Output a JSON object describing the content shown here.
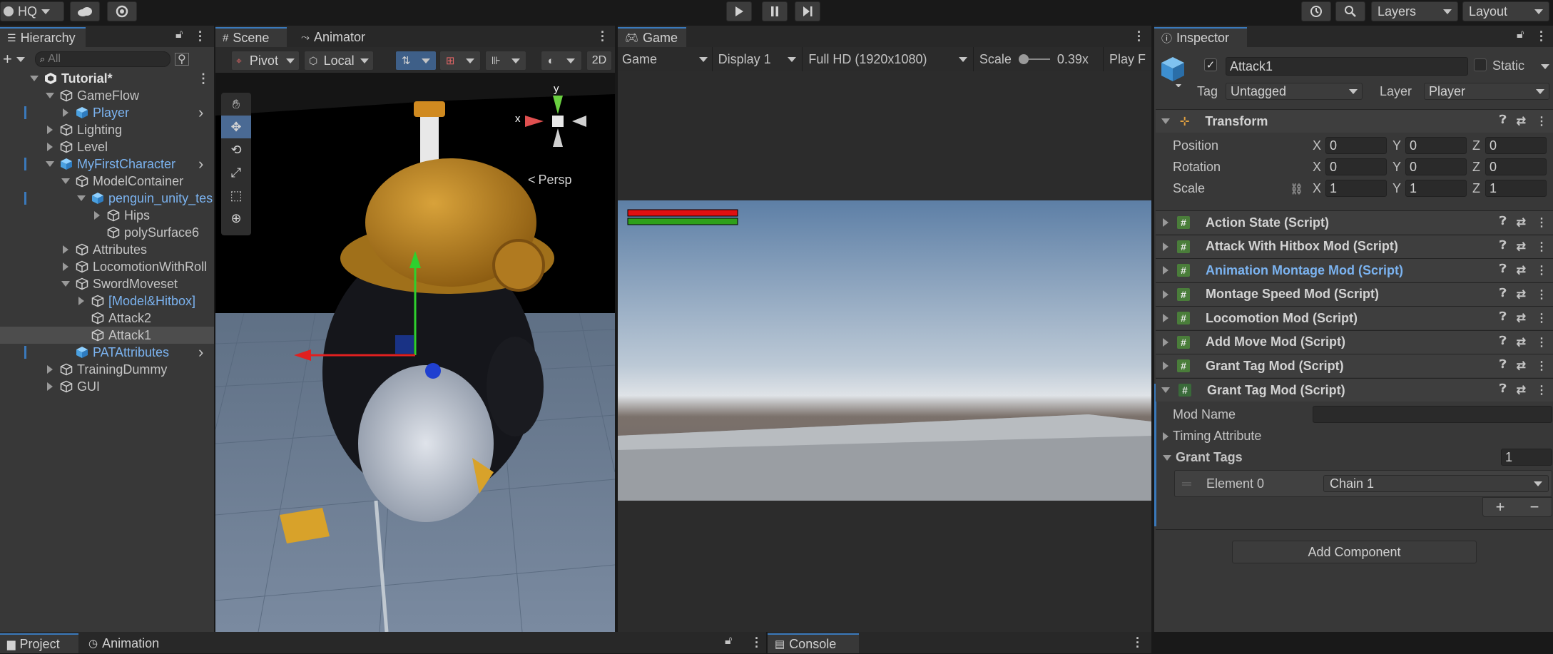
{
  "toolbar": {
    "account": "HQ",
    "layers": "Layers",
    "layout": "Layout"
  },
  "hierarchy": {
    "tab": "Hierarchy",
    "search_placeholder": "All",
    "rows": [
      {
        "label": "Tutorial*",
        "indent": 0,
        "fold": "open",
        "kind": "scene"
      },
      {
        "label": "GameFlow",
        "indent": 1,
        "fold": "open",
        "kind": "go"
      },
      {
        "label": "Player",
        "indent": 2,
        "fold": "closed",
        "kind": "prefab"
      },
      {
        "label": "Lighting",
        "indent": 1,
        "fold": "closed",
        "kind": "go"
      },
      {
        "label": "Level",
        "indent": 1,
        "fold": "closed",
        "kind": "go"
      },
      {
        "label": "MyFirstCharacter",
        "indent": 1,
        "fold": "open",
        "kind": "prefab"
      },
      {
        "label": "ModelContainer",
        "indent": 2,
        "fold": "open",
        "kind": "go"
      },
      {
        "label": "penguin_unity_tes",
        "indent": 3,
        "fold": "open",
        "kind": "prefab"
      },
      {
        "label": "Hips",
        "indent": 4,
        "fold": "closed",
        "kind": "go"
      },
      {
        "label": "polySurface6",
        "indent": 4,
        "fold": "none",
        "kind": "go"
      },
      {
        "label": "Attributes",
        "indent": 2,
        "fold": "closed",
        "kind": "go"
      },
      {
        "label": "LocomotionWithRoll",
        "indent": 2,
        "fold": "closed",
        "kind": "go"
      },
      {
        "label": "SwordMoveset",
        "indent": 2,
        "fold": "open",
        "kind": "go"
      },
      {
        "label": "[Model&Hitbox]",
        "indent": 3,
        "fold": "closed",
        "kind": "goblue"
      },
      {
        "label": "Attack2",
        "indent": 3,
        "fold": "none",
        "kind": "go"
      },
      {
        "label": "Attack1",
        "indent": 3,
        "fold": "none",
        "kind": "go",
        "selected": true
      },
      {
        "label": "PATAttributes",
        "indent": 2,
        "fold": "none",
        "kind": "prefab"
      },
      {
        "label": "TrainingDummy",
        "indent": 1,
        "fold": "closed",
        "kind": "go"
      },
      {
        "label": "GUI",
        "indent": 1,
        "fold": "closed",
        "kind": "go"
      }
    ]
  },
  "scene": {
    "tab_scene": "Scene",
    "tab_animator": "Animator",
    "pivot": "Pivot",
    "local": "Local",
    "mode_2d": "2D",
    "persp": "Persp",
    "axis_x": "x",
    "axis_y": "y"
  },
  "game": {
    "tab": "Game",
    "view": "Game",
    "display": "Display 1",
    "resolution": "Full HD (1920x1080)",
    "scale_label": "Scale",
    "scale_value": "0.39x",
    "play": "Play F"
  },
  "inspector": {
    "tab": "Inspector",
    "object_name": "Attack1",
    "static_label": "Static",
    "tag_label": "Tag",
    "tag_value": "Untagged",
    "layer_label": "Layer",
    "layer_value": "Player",
    "transform": {
      "title": "Transform",
      "position_label": "Position",
      "rotation_label": "Rotation",
      "scale_label": "Scale",
      "position": [
        "0",
        "0",
        "0"
      ],
      "rotation": [
        "0",
        "0",
        "0"
      ],
      "scale": [
        "1",
        "1",
        "1"
      ],
      "x": "X",
      "y": "Y",
      "z": "Z"
    },
    "components": [
      {
        "name": "Action State (Script)",
        "highlight": false
      },
      {
        "name": "Attack With Hitbox Mod (Script)",
        "highlight": false
      },
      {
        "name": "Animation Montage Mod (Script)",
        "highlight": true
      },
      {
        "name": "Montage Speed Mod (Script)",
        "highlight": false
      },
      {
        "name": "Locomotion Mod (Script)",
        "highlight": false
      },
      {
        "name": "Add Move Mod (Script)",
        "highlight": false
      },
      {
        "name": "Grant Tag Mod (Script)",
        "highlight": false
      }
    ],
    "expanded_component": {
      "name": "Grant Tag Mod (Script)",
      "mod_name_label": "Mod Name",
      "mod_name_value": "",
      "timing_label": "Timing Attribute",
      "grant_tags_label": "Grant Tags",
      "grant_tags_count": "1",
      "element_label": "Element 0",
      "element_value": "Chain 1",
      "plus": "+",
      "minus": "−"
    },
    "add_component": "Add Component"
  },
  "bottom": {
    "project": "Project",
    "animation": "Animation",
    "console": "Console"
  },
  "colors": {
    "accent": "#3a79bb",
    "prefab_text": "#7bb3f0",
    "health_red": "#e01010",
    "health_green": "#2ea01a"
  }
}
